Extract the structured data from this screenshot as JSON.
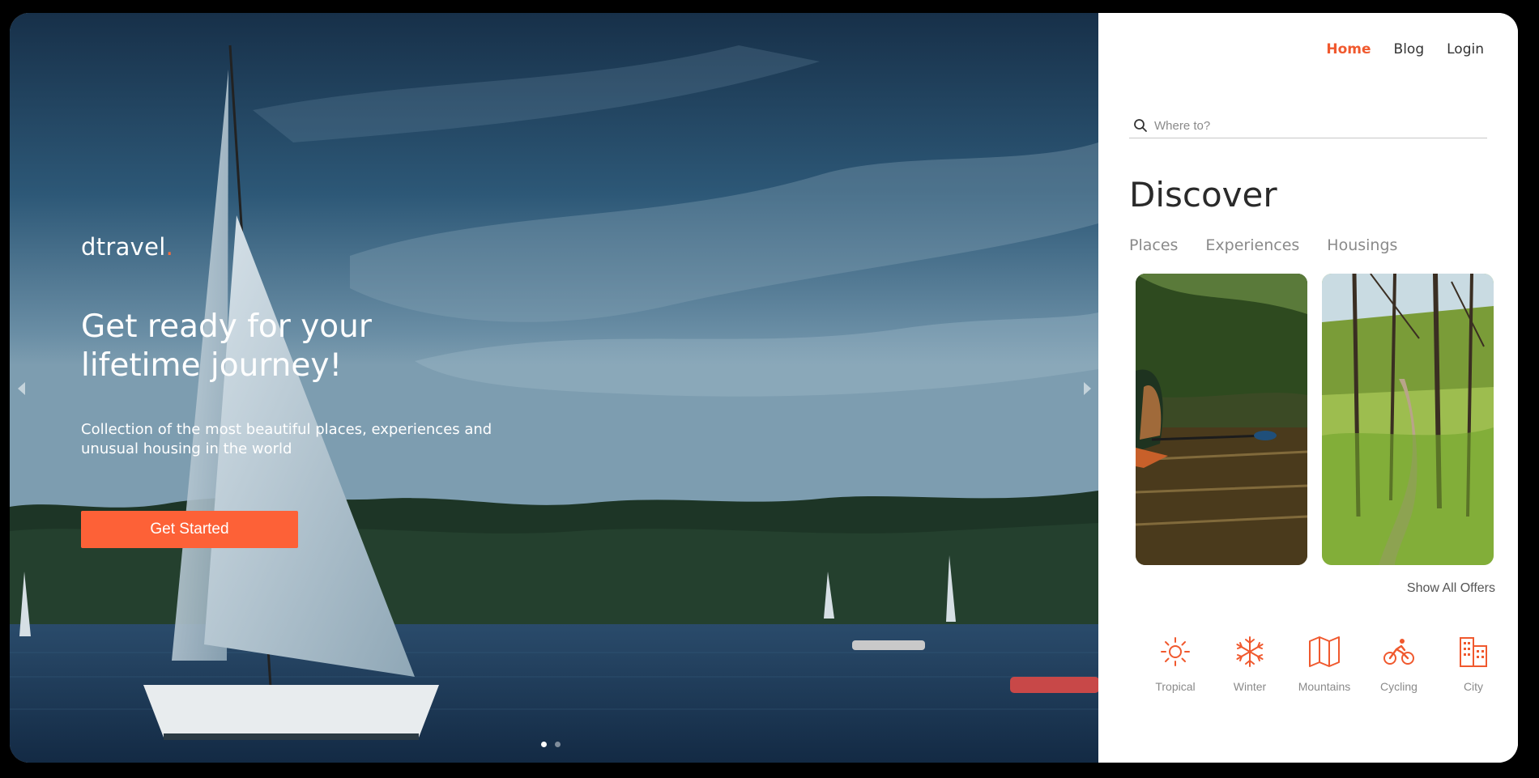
{
  "hero": {
    "brand": "dtravel",
    "brand_dot": ".",
    "headline": "Get ready for your lifetime journey!",
    "subline": "Collection of the most beautiful places, experiences and unusual housing in the world",
    "cta_label": "Get Started",
    "slides": 2,
    "active_slide": 1
  },
  "nav": {
    "items": [
      {
        "label": "Home",
        "active": true
      },
      {
        "label": "Blog",
        "active": false
      },
      {
        "label": "Login",
        "active": false
      }
    ]
  },
  "search": {
    "placeholder": "Where to?"
  },
  "discover": {
    "title": "Discover",
    "tabs": [
      "Places",
      "Experiences",
      "Housings"
    ],
    "show_all": "Show All Offers"
  },
  "categories": [
    {
      "label": "Tropical",
      "icon": "sun-icon"
    },
    {
      "label": "Winter",
      "icon": "snowflake-icon"
    },
    {
      "label": "Mountains",
      "icon": "map-icon"
    },
    {
      "label": "Cycling",
      "icon": "cyclist-icon"
    },
    {
      "label": "City",
      "icon": "building-icon"
    }
  ],
  "colors": {
    "accent": "#fd6137",
    "text": "#333333",
    "muted": "#8a8a8a"
  }
}
